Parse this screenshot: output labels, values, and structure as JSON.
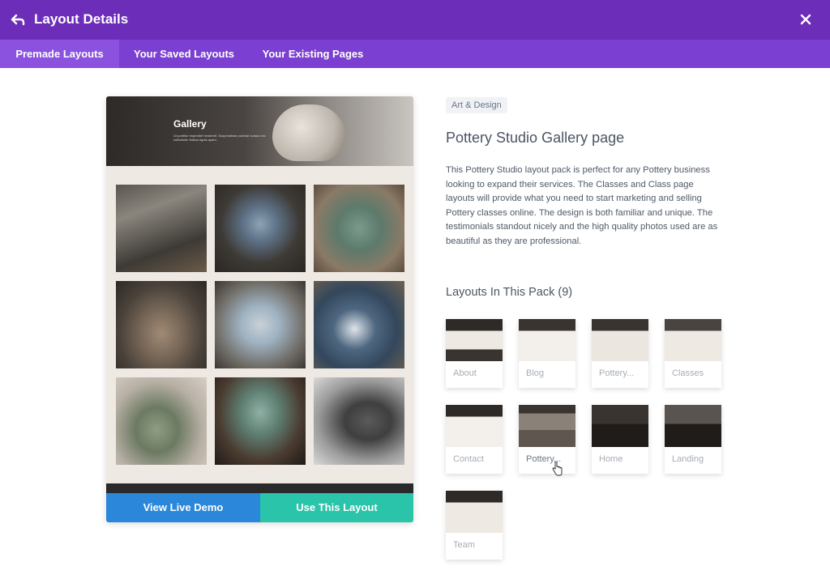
{
  "header": {
    "title": "Layout Details"
  },
  "tabs": [
    {
      "label": "Premade Layouts",
      "active": true
    },
    {
      "label": "Your Saved Layouts",
      "active": false
    },
    {
      "label": "Your Existing Pages",
      "active": false
    }
  ],
  "preview": {
    "hero_title": "Gallery",
    "hero_subtitle": "Ut porttitor imperdiet hendrerit. Suspendisse pulvinar cursus nec sollicitudin finibus ligula quam.",
    "buttons": {
      "demo": "View Live Demo",
      "use": "Use This Layout"
    }
  },
  "details": {
    "category": "Art & Design",
    "title": "Pottery Studio Gallery page",
    "description": "This Pottery Studio layout pack is perfect for any Pottery business looking to expand their services. The Classes and Class page layouts will provide what you need to start marketing and selling Pottery classes online. The design is both familiar and unique. The testimonials standout nicely and the high quality photos used are as beautiful as they are professional.",
    "pack_heading": "Layouts In This Pack (9)"
  },
  "layouts": [
    {
      "label": "About"
    },
    {
      "label": "Blog"
    },
    {
      "label": "Pottery..."
    },
    {
      "label": "Classes"
    },
    {
      "label": "Contact"
    },
    {
      "label": "Pottery..."
    },
    {
      "label": "Home"
    },
    {
      "label": "Landing"
    },
    {
      "label": "Team"
    }
  ],
  "colors": {
    "header": "#6c2eb9",
    "tabs": "#7b3fd1",
    "demo_button": "#2b87da",
    "use_button": "#29c4a9"
  }
}
